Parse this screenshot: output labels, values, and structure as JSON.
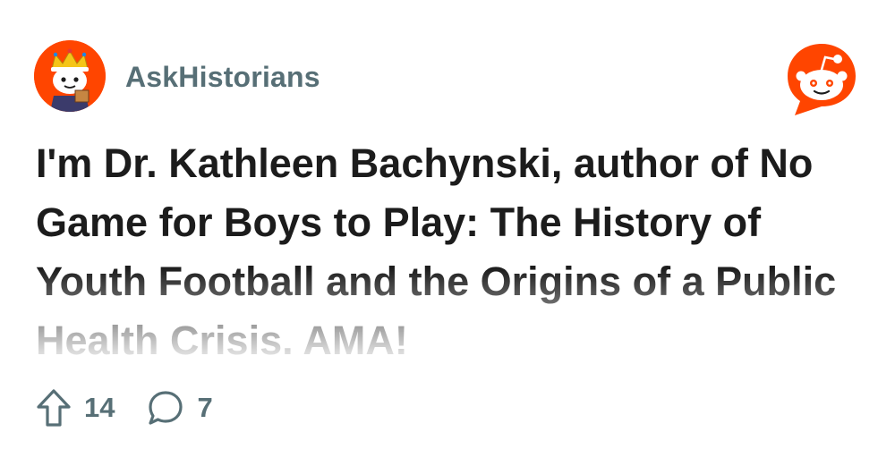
{
  "subreddit": {
    "name": "AskHistorians",
    "avatar_icon": "askhistorians-king-snoo-icon"
  },
  "brand": {
    "logo_icon": "reddit-snoo-logo-icon",
    "accent": "#ff4500"
  },
  "post": {
    "title": "I'm Dr. Kathleen Bachynski, author of No Game for Boys to Play: The History of Youth Football and the Origins of a Public Health Crisis. AMA!",
    "upvotes": "14",
    "comments": "7",
    "upvote_icon": "upvote-arrow-icon",
    "comment_icon": "comment-bubble-icon"
  },
  "colors": {
    "title_text": "#1c1c1c",
    "meta_text": "#576f76"
  }
}
